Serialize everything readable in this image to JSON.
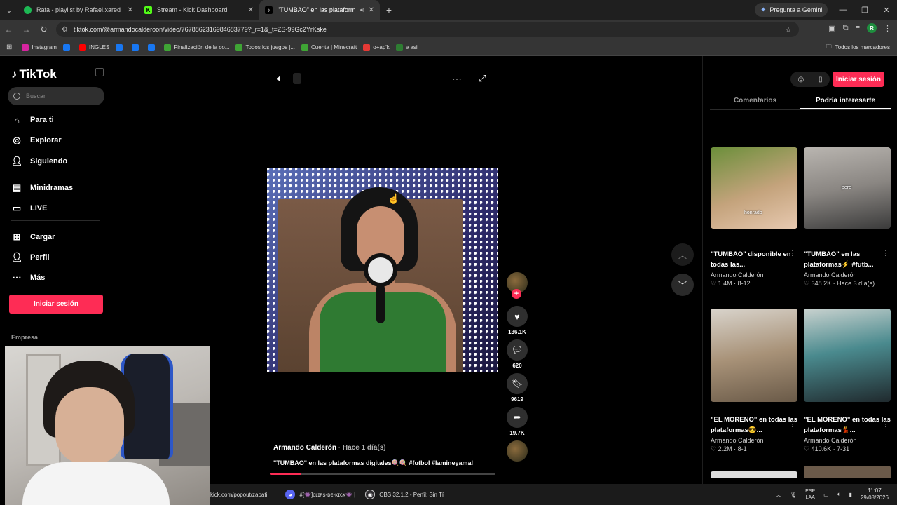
{
  "browser": {
    "tabs": [
      {
        "title": "Rafa - playlist by Rafael.xared |",
        "color": "#1db954",
        "active": false
      },
      {
        "title": "Stream - Kick Dashboard",
        "color": "#53fc18",
        "active": false
      },
      {
        "title": "\"TUMBAO\" en las plataform",
        "color": "#000000",
        "active": true
      }
    ],
    "gemini_label": "Pregunta a Gemini",
    "url": "tiktok.com/@armandocalderoon/video/7678862316984683779?_r=1&_t=ZS-99Gc2YrKske",
    "profile_initial": "R",
    "bookmarks": [
      {
        "label": "Instagram",
        "color": "#d6249f"
      },
      {
        "label": "",
        "color": "#1877f2"
      },
      {
        "label": "INGLES",
        "color": "#ff0000"
      },
      {
        "label": "",
        "color": "#1877f2"
      },
      {
        "label": "",
        "color": "#1877f2"
      },
      {
        "label": "",
        "color": "#1877f2"
      },
      {
        "label": "Finalización de la co...",
        "color": "#3fa535"
      },
      {
        "label": "Todos los juegos |...",
        "color": "#3fa535"
      },
      {
        "label": "Cuenta | Minecraft",
        "color": "#3fa535"
      },
      {
        "label": "o+ap'k",
        "color": "#e53935"
      },
      {
        "label": "e asi",
        "color": "#2e7d32"
      }
    ],
    "all_bookmarks": "Todos los marcadores"
  },
  "sidebar": {
    "brand": "TikTok",
    "search_placeholder": "Buscar",
    "items": [
      {
        "label": "Para ti",
        "icon": "home-icon"
      },
      {
        "label": "Explorar",
        "icon": "compass-icon"
      },
      {
        "label": "Siguiendo",
        "icon": "following-icon"
      },
      {
        "label": "Minidramas",
        "icon": "film-icon"
      },
      {
        "label": "LIVE",
        "icon": "live-icon"
      },
      {
        "label": "Cargar",
        "icon": "upload-icon"
      },
      {
        "label": "Perfil",
        "icon": "profile-icon"
      },
      {
        "label": "Más",
        "icon": "more-icon"
      }
    ],
    "login_label": "Iniciar sesión",
    "empresa_label": "Empresa"
  },
  "video": {
    "author": "Armando Calderón",
    "posted": "· Hace 1 día(s)",
    "description": "\"TUMBAO\" en las plataformas digitales🍭🍭 #futbol #lamineyamal",
    "progress": 0.14,
    "likes": "136.1K",
    "comments": "620",
    "saves": "9619",
    "shares": "19.7K"
  },
  "right_panel": {
    "login_label": "Iniciar sesión",
    "tabs": [
      "Comentarios",
      "Podría interesarte"
    ],
    "cards": [
      {
        "title": "\"TUMBAO\" disponible en todas las...",
        "author": "Armando Calderón",
        "likes": "1.4M",
        "date": "8-12",
        "thumb_label": "honrado"
      },
      {
        "title": "\"TUMBAO\" en las plataformas⚡ #futb...",
        "author": "Armando Calderón",
        "likes": "348.2K",
        "date": "Hace 3 día(s)",
        "thumb_label": "pero"
      },
      {
        "title": "\"EL MORENO\" en todas las plataformas😎...",
        "author": "Armando Calderón",
        "likes": "2.2M",
        "date": "8-1",
        "thumb_label": ""
      },
      {
        "title": "\"EL MORENO\" en todas las plataformas💃...",
        "author": "Armando Calderón",
        "likes": "410.6K",
        "date": "7-31",
        "thumb_label": ""
      }
    ]
  },
  "taskbar": {
    "items": [
      "kick.com/popout/zapati",
      "#[👾]ᴄʟɪᴘs-ᴅᴇ-ᴋɪᴄᴋ👾 |",
      "OBS 32.1.2 - Perfil: Sin Tí"
    ],
    "lang_top": "ESP",
    "lang_bottom": "LAA",
    "time": "11:07",
    "date": "29/08/2026"
  }
}
